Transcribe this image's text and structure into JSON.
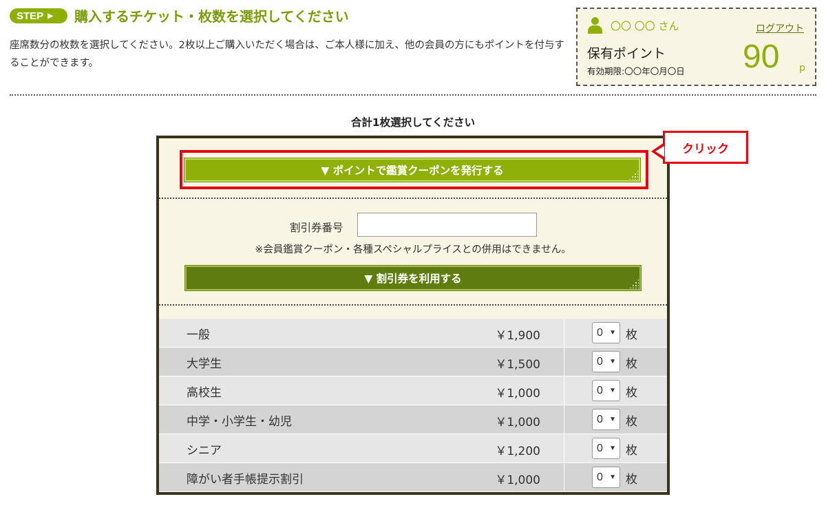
{
  "header": {
    "step_label": "STEP",
    "title": "購入するチケット・枚数を選択してください",
    "intro": "座席数分の枚数を選択してください。2枚以上ご購入いただく場合は、ご本人様に加え、他の会員の方にもポイントを付与することができます。"
  },
  "point_box": {
    "user_name": "〇〇 〇〇 さん",
    "logout": "ログアウト",
    "label": "保有ポイント",
    "expiry": "有効期限:〇〇年〇月〇日",
    "value": "90",
    "unit": "p"
  },
  "selection": {
    "total_message": "合計1枚選択してください",
    "point_coupon_button": "▼ ポイントで鑑賞クーポンを発行する",
    "callout": "クリック",
    "discount_code_label": "割引券番号",
    "discount_code_value": "",
    "discount_note": "※会員鑑賞クーポン・各種スペシャルプライスとの併用はできません。",
    "discount_button": "▼ 割引券を利用する"
  },
  "tickets": [
    {
      "name": "一般",
      "price": "￥1,900",
      "qty": "0",
      "unit": "枚"
    },
    {
      "name": "大学生",
      "price": "￥1,500",
      "qty": "0",
      "unit": "枚"
    },
    {
      "name": "高校生",
      "price": "￥1,000",
      "qty": "0",
      "unit": "枚"
    },
    {
      "name": "中学・小学生・幼児",
      "price": "￥1,000",
      "qty": "0",
      "unit": "枚"
    },
    {
      "name": "シニア",
      "price": "￥1,200",
      "qty": "0",
      "unit": "枚"
    },
    {
      "name": "障がい者手帳提示割引",
      "price": "￥1,000",
      "qty": "0",
      "unit": "枚"
    }
  ],
  "icons": {
    "step_arrow": "triangle-right-icon",
    "user": "user-icon",
    "select_arrow": "triangle-down-icon"
  },
  "colors": {
    "accent_green": "#8fb008",
    "dark_green": "#5e7d0e",
    "highlight_red": "#e60012",
    "panel_border": "#3a3219",
    "panel_bg": "#f8f5e4"
  }
}
